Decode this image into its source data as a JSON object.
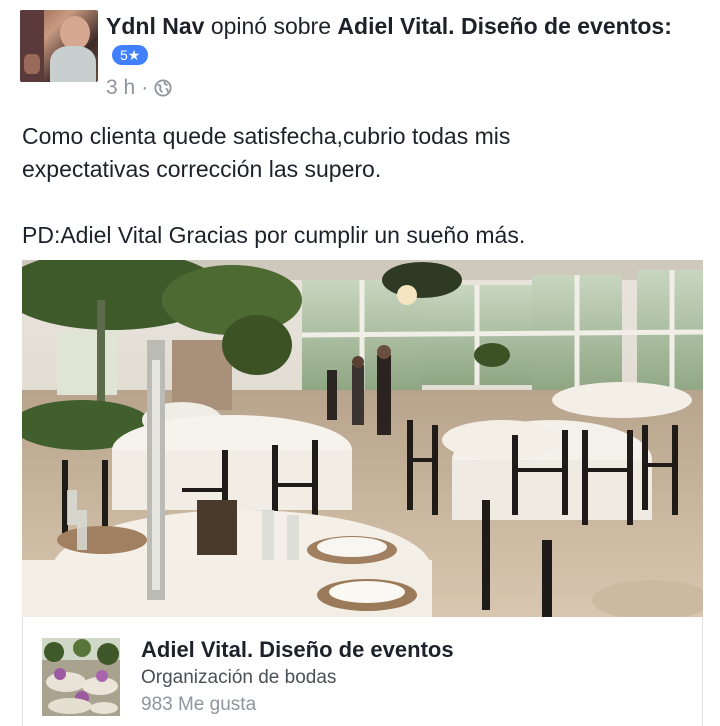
{
  "post": {
    "author": "Ydnl Nav",
    "action_text": "opinó sobre",
    "page_name": "Adiel Vital. Diseño de eventos:",
    "rating": "5★",
    "time": "3 h",
    "separator": "·",
    "icons": {
      "privacy": "globe-icon"
    },
    "text_line1": "Como clienta quede satisfecha,cubrio todas mis",
    "text_line2": "expectativas corrección las supero.",
    "text_line3": "PD:Adiel Vital Gracias por cumplir un sueño más."
  },
  "link_card": {
    "title": "Adiel Vital. Diseño de eventos",
    "category": "Organización de bodas",
    "likes": "983 Me gusta"
  },
  "colors": {
    "rating_badge": "#4080ff",
    "text": "#1d2129",
    "meta": "#90949c"
  }
}
